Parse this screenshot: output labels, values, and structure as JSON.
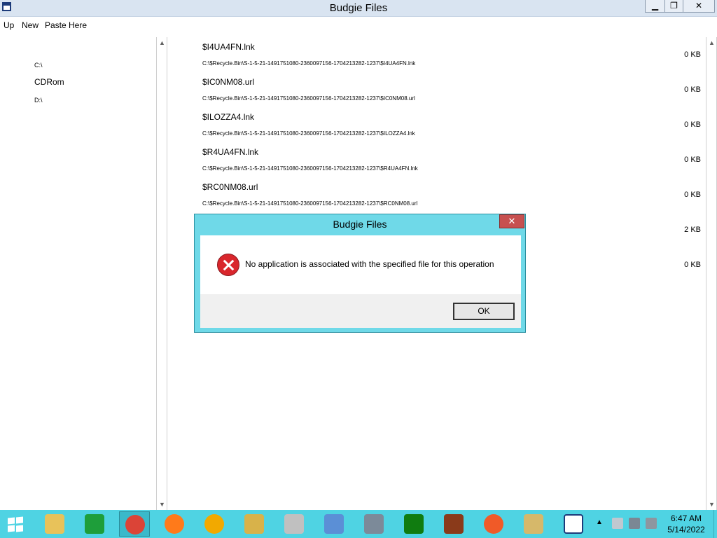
{
  "window": {
    "title": "Budgie Files",
    "controls": {
      "minimize": "▁",
      "maximize": "❐",
      "close": "✕"
    }
  },
  "menu": [
    "Up",
    "New",
    "Paste Here"
  ],
  "drives": [
    "C:\\",
    "CDRom",
    "D:\\"
  ],
  "files": [
    {
      "name": "$I4UA4FN.lnk",
      "path": "C:\\$Recycle.Bin\\S-1-5-21-1491751080-2360097156-1704213282-1237\\$I4UA4FN.lnk",
      "size": "0 KB"
    },
    {
      "name": "$IC0NM08.url",
      "path": "C:\\$Recycle.Bin\\S-1-5-21-1491751080-2360097156-1704213282-1237\\$IC0NM08.url",
      "size": "0 KB"
    },
    {
      "name": "$ILOZZA4.lnk",
      "path": "C:\\$Recycle.Bin\\S-1-5-21-1491751080-2360097156-1704213282-1237\\$ILOZZA4.lnk",
      "size": "0 KB"
    },
    {
      "name": "$R4UA4FN.lnk",
      "path": "C:\\$Recycle.Bin\\S-1-5-21-1491751080-2360097156-1704213282-1237\\$R4UA4FN.lnk",
      "size": "0 KB"
    },
    {
      "name": "$RC0NM08.url",
      "path": "C:\\$Recycle.Bin\\S-1-5-21-1491751080-2360097156-1704213282-1237\\$RC0NM08.url",
      "size": "0 KB"
    }
  ],
  "hidden_sizes": [
    "2 KB",
    "0 KB"
  ],
  "dialog": {
    "title": "Budgie Files",
    "close": "✕",
    "message": "No application is associated with the specified file for this operation",
    "ok_label": "OK"
  },
  "scroll": {
    "up": "▲",
    "down": "▼"
  },
  "taskbar": {
    "apps": [
      {
        "name": "file-explorer",
        "color": "#e8c25a"
      },
      {
        "name": "store",
        "color": "#1e9e3a"
      },
      {
        "name": "chrome",
        "color": "#db4437",
        "active": true
      },
      {
        "name": "firefox",
        "color": "#ff7a1a"
      },
      {
        "name": "avast-secure-browser",
        "color": "#f2a900"
      },
      {
        "name": "archive-manager",
        "color": "#d8b24a"
      },
      {
        "name": "tools",
        "color": "#c0c0c0"
      },
      {
        "name": "remote-desktop",
        "color": "#5b8fd6"
      },
      {
        "name": "server-manager",
        "color": "#7c8a99"
      },
      {
        "name": "xbox",
        "color": "#107c10"
      },
      {
        "name": "game",
        "color": "#8a3a1a"
      },
      {
        "name": "swift",
        "color": "#f05a28"
      },
      {
        "name": "archive",
        "color": "#d6b86a"
      },
      {
        "name": "budgie-files",
        "color": "#1d3b7a"
      }
    ],
    "tray_arrow": "▲",
    "clock_time": "6:47 AM",
    "clock_date": "5/14/2022"
  }
}
